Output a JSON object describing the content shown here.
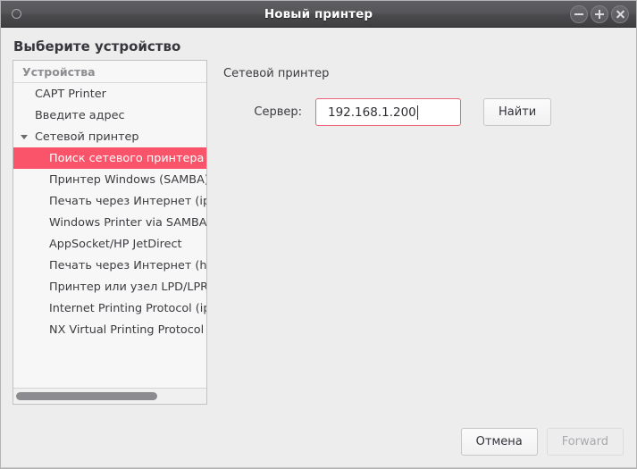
{
  "window": {
    "title": "Новый принтер",
    "left_icon": "circle-icon",
    "controls": [
      {
        "name": "minimize",
        "glyph": "−"
      },
      {
        "name": "maximize",
        "glyph": "+"
      },
      {
        "name": "close",
        "glyph": "×"
      }
    ]
  },
  "heading": "Выберите устройство",
  "tree": {
    "column_header": "Устройства",
    "rows": [
      {
        "label": "CAPT Printer",
        "level": 0,
        "expander": false,
        "selected": false
      },
      {
        "label": "Введите адрес",
        "level": 0,
        "expander": false,
        "selected": false
      },
      {
        "label": "Сетевой принтер",
        "level": 0,
        "expander": true,
        "selected": false
      },
      {
        "label": "Поиск сетевого принтера",
        "level": 1,
        "expander": false,
        "selected": true
      },
      {
        "label": "Принтер Windows (SAMBA)",
        "level": 1,
        "expander": false,
        "selected": false
      },
      {
        "label": "Печать через Интернет (ipp)",
        "level": 1,
        "expander": false,
        "selected": false
      },
      {
        "label": "Windows Printer via SAMBA",
        "level": 1,
        "expander": false,
        "selected": false
      },
      {
        "label": "AppSocket/HP JetDirect",
        "level": 1,
        "expander": false,
        "selected": false
      },
      {
        "label": "Печать через Интернет (https)",
        "level": 1,
        "expander": false,
        "selected": false
      },
      {
        "label": "Принтер или узел LPD/LPR",
        "level": 1,
        "expander": false,
        "selected": false
      },
      {
        "label": "Internet Printing Protocol (ipp)",
        "level": 1,
        "expander": false,
        "selected": false
      },
      {
        "label": "NX Virtual Printing Protocol",
        "level": 1,
        "expander": false,
        "selected": false
      }
    ],
    "scrollbar": {
      "thumb_percent": 75
    }
  },
  "form": {
    "title": "Сетевой принтер",
    "server_label": "Сервер:",
    "server_value": "192.168.1.200",
    "server_placeholder": "",
    "find_button": "Найти"
  },
  "footer": {
    "cancel_label": "Отмена",
    "forward_label": "Forward",
    "forward_disabled": true
  },
  "colors": {
    "selection": "#f9546a",
    "input_focus_border": "#ef6377",
    "titlebar_top": "#5f5f63",
    "titlebar_bottom": "#3e3e41",
    "dialog_background": "#ededed"
  }
}
